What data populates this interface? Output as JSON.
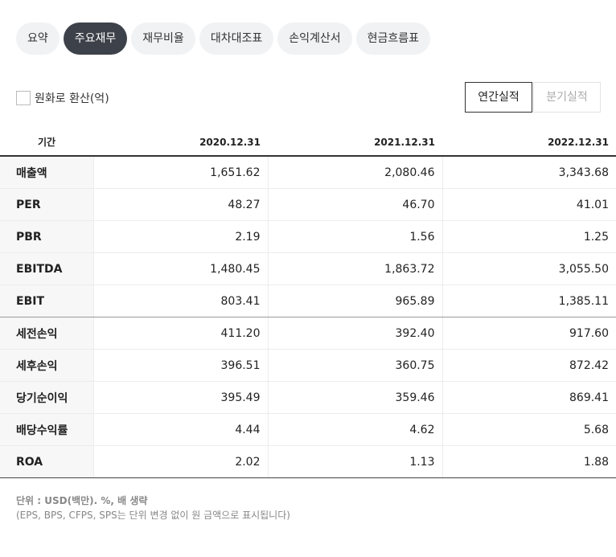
{
  "tabs": [
    {
      "label": "요약",
      "active": false
    },
    {
      "label": "주요재무",
      "active": true
    },
    {
      "label": "재무비율",
      "active": false
    },
    {
      "label": "대차대조표",
      "active": false
    },
    {
      "label": "손익계산서",
      "active": false
    },
    {
      "label": "현금흐름표",
      "active": false
    }
  ],
  "convert_label": "원화로 환산(억)",
  "period": {
    "annual": "연간실적",
    "quarterly": "분기실적"
  },
  "table": {
    "header": {
      "label": "기간",
      "periods": [
        "2020.12.31",
        "2021.12.31",
        "2022.12.31"
      ]
    },
    "rows": [
      {
        "label": "매출액",
        "values": [
          "1,651.62",
          "2,080.46",
          "3,343.68"
        ]
      },
      {
        "label": "PER",
        "values": [
          "48.27",
          "46.70",
          "41.01"
        ]
      },
      {
        "label": "PBR",
        "values": [
          "2.19",
          "1.56",
          "1.25"
        ]
      },
      {
        "label": "EBITDA",
        "values": [
          "1,480.45",
          "1,863.72",
          "3,055.50"
        ]
      },
      {
        "label": "EBIT",
        "values": [
          "803.41",
          "965.89",
          "1,385.11"
        ]
      },
      {
        "label": "세전손익",
        "values": [
          "411.20",
          "392.40",
          "917.60"
        ]
      },
      {
        "label": "세후손익",
        "values": [
          "396.51",
          "360.75",
          "872.42"
        ]
      },
      {
        "label": "당기순이익",
        "values": [
          "395.49",
          "359.46",
          "869.41"
        ]
      },
      {
        "label": "배당수익률",
        "values": [
          "4.44",
          "4.62",
          "5.68"
        ]
      },
      {
        "label": "ROA",
        "values": [
          "2.02",
          "1.13",
          "1.88"
        ]
      }
    ]
  },
  "footnote": {
    "unit": "단위 : USD(백만). %, 배 생략",
    "note": "(EPS, BPS, CFPS, SPS는 단위 변경 없이 원 금액으로 표시됩니다)"
  }
}
